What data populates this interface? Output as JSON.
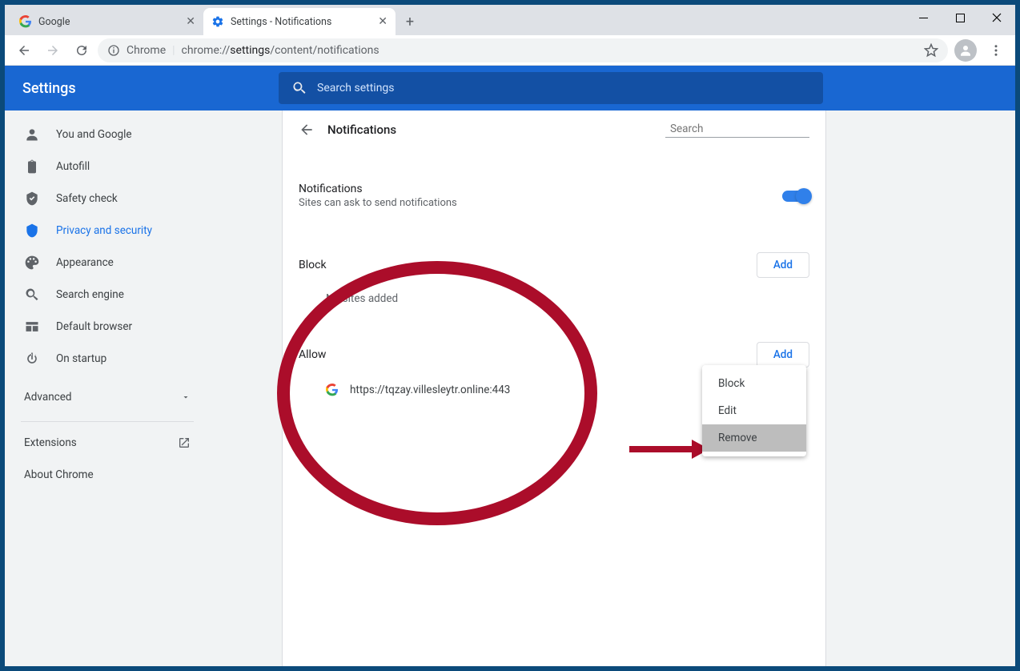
{
  "tabs": {
    "tab0": {
      "title": "Google"
    },
    "tab1": {
      "title": "Settings - Notifications"
    }
  },
  "address": {
    "prefix": "Chrome",
    "url_gray1": "chrome://",
    "url_dark": "settings",
    "url_gray2": "/content/notifications"
  },
  "header": {
    "title": "Settings",
    "search_placeholder": "Search settings"
  },
  "sidebar": {
    "items": [
      {
        "label": "You and Google"
      },
      {
        "label": "Autofill"
      },
      {
        "label": "Safety check"
      },
      {
        "label": "Privacy and security"
      },
      {
        "label": "Appearance"
      },
      {
        "label": "Search engine"
      },
      {
        "label": "Default browser"
      },
      {
        "label": "On startup"
      }
    ],
    "advanced": "Advanced",
    "extensions": "Extensions",
    "about": "About Chrome"
  },
  "page": {
    "title": "Notifications",
    "search_placeholder": "Search",
    "notifications_label": "Notifications",
    "notifications_sub": "Sites can ask to send notifications",
    "block_label": "Block",
    "block_add": "Add",
    "block_empty": "No sites added",
    "allow_label": "Allow",
    "allow_add": "Add",
    "allow_site": "https://tqzay.villesleytr.online:443"
  },
  "context_menu": {
    "block": "Block",
    "edit": "Edit",
    "remove": "Remove"
  }
}
